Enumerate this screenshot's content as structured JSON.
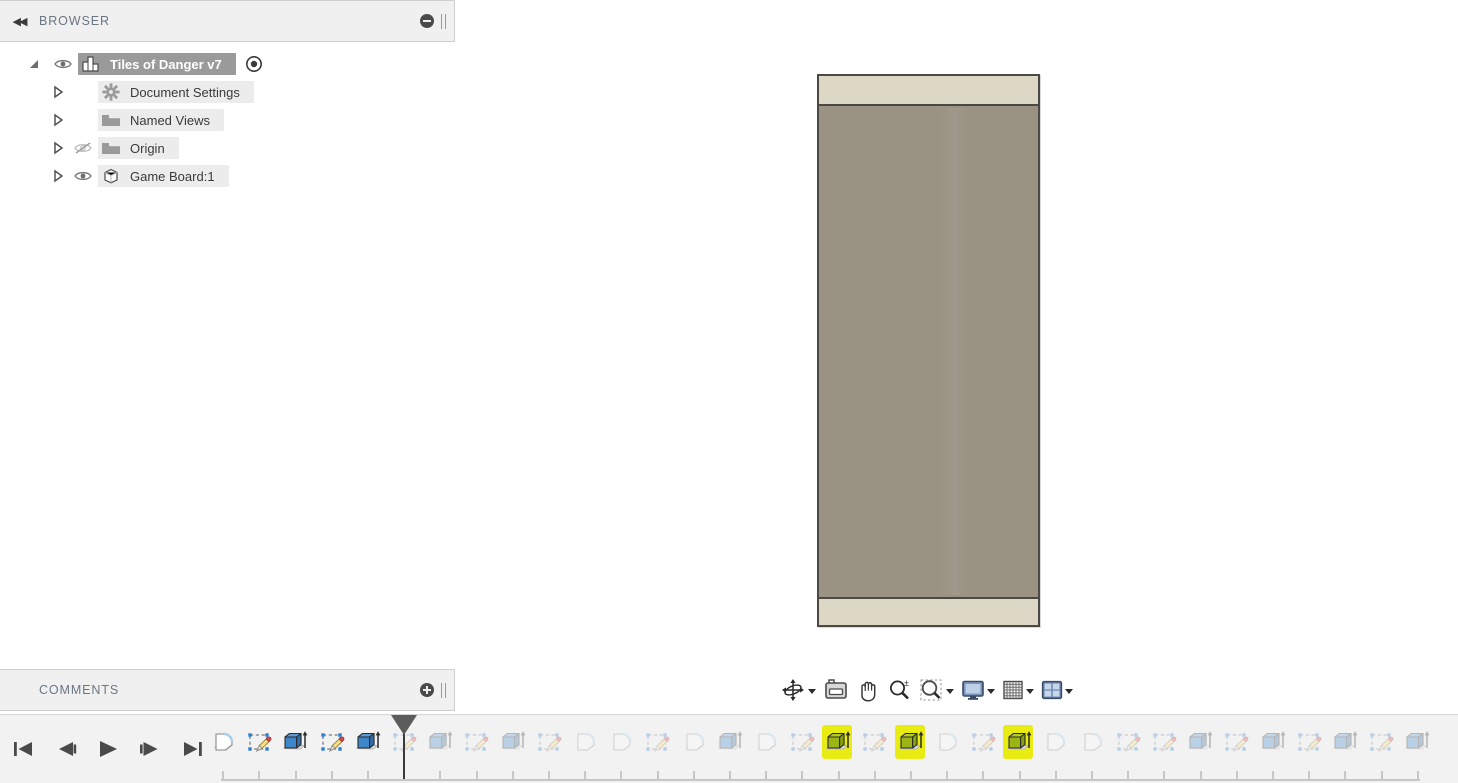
{
  "app": {
    "background": "#ffffff"
  },
  "browser": {
    "title": "BROWSER",
    "collapse_icon": "double-left-arrow-icon",
    "minimize_icon": "minus-circle-icon",
    "grip_icon": "drag-grip-icon",
    "tree": [
      {
        "label": "Tiles of Danger v7",
        "icon": "component-icon",
        "expander": "expanded-triangle-icon",
        "eye": "eye-visible-icon",
        "selected": true,
        "indent": 0,
        "has_target": true,
        "target_icon": "activate-component-icon"
      },
      {
        "label": "Document Settings",
        "icon": "gear-icon",
        "expander": "collapsed-triangle-icon",
        "eye": null,
        "selected": false,
        "indent": 1,
        "has_target": false
      },
      {
        "label": "Named Views",
        "icon": "folder-icon",
        "expander": "collapsed-triangle-icon",
        "eye": null,
        "selected": false,
        "indent": 1,
        "has_target": false
      },
      {
        "label": "Origin",
        "icon": "folder-icon",
        "expander": "collapsed-triangle-icon",
        "eye": "eye-hidden-icon",
        "selected": false,
        "indent": 1,
        "has_target": false
      },
      {
        "label": "Game Board:1",
        "icon": "body-cube-icon",
        "expander": "collapsed-triangle-icon",
        "eye": "eye-visible-icon",
        "selected": false,
        "indent": 1,
        "has_target": false
      }
    ]
  },
  "comments": {
    "title": "COMMENTS",
    "add_icon": "plus-circle-icon",
    "grip_icon": "drag-grip-icon"
  },
  "viewport": {
    "model": {
      "name": "game-board-model",
      "body_color": "#9a9384",
      "band_color": "#ddd8c6",
      "edge_color": "#4a4944"
    }
  },
  "navbar": {
    "buttons": [
      {
        "name": "orbit-icon",
        "label": "Orbit",
        "has_caret": true
      },
      {
        "name": "look-at-icon",
        "label": "Look At",
        "has_caret": false
      },
      {
        "name": "pan-hand-icon",
        "label": "Pan",
        "has_caret": false
      },
      {
        "name": "zoom-icon",
        "label": "Zoom",
        "has_caret": false
      },
      {
        "name": "zoom-window-icon",
        "label": "Zoom Window",
        "has_caret": true
      },
      {
        "name": "display-settings-icon",
        "label": "Display Settings",
        "has_caret": true
      },
      {
        "name": "grid-snap-icon",
        "label": "Grid and Snaps",
        "has_caret": true
      },
      {
        "name": "viewports-icon",
        "label": "Viewports",
        "has_caret": true
      }
    ]
  },
  "timeline": {
    "playback": [
      {
        "name": "skip-to-start-button",
        "icon": "skip-start-icon"
      },
      {
        "name": "step-back-button",
        "icon": "step-back-icon"
      },
      {
        "name": "play-button",
        "icon": "play-icon"
      },
      {
        "name": "step-forward-button",
        "icon": "step-forward-icon"
      },
      {
        "name": "skip-to-end-button",
        "icon": "skip-end-icon"
      }
    ],
    "playhead_index": 5,
    "highlight_color": "#e8ec12",
    "features": [
      {
        "type": "component",
        "state": "active"
      },
      {
        "type": "sketch",
        "state": "active"
      },
      {
        "type": "extrude",
        "state": "active"
      },
      {
        "type": "sketch",
        "state": "active"
      },
      {
        "type": "extrude",
        "state": "active"
      },
      {
        "type": "sketch",
        "state": "rolled-back"
      },
      {
        "type": "extrude",
        "state": "rolled-back"
      },
      {
        "type": "sketch",
        "state": "rolled-back"
      },
      {
        "type": "extrude",
        "state": "rolled-back"
      },
      {
        "type": "sketch",
        "state": "rolled-back"
      },
      {
        "type": "fillet",
        "state": "rolled-back"
      },
      {
        "type": "fillet",
        "state": "rolled-back"
      },
      {
        "type": "sketch",
        "state": "rolled-back"
      },
      {
        "type": "fillet",
        "state": "rolled-back"
      },
      {
        "type": "extrude",
        "state": "rolled-back"
      },
      {
        "type": "fillet",
        "state": "rolled-back"
      },
      {
        "type": "sketch",
        "state": "rolled-back"
      },
      {
        "type": "extrude",
        "state": "highlighted"
      },
      {
        "type": "sketch",
        "state": "rolled-back"
      },
      {
        "type": "extrude",
        "state": "highlighted"
      },
      {
        "type": "fillet",
        "state": "rolled-back"
      },
      {
        "type": "sketch",
        "state": "rolled-back"
      },
      {
        "type": "extrude",
        "state": "highlighted"
      },
      {
        "type": "fillet",
        "state": "rolled-back"
      },
      {
        "type": "fillet",
        "state": "rolled-back"
      },
      {
        "type": "sketch",
        "state": "rolled-back"
      },
      {
        "type": "sketch",
        "state": "rolled-back"
      },
      {
        "type": "extrude",
        "state": "rolled-back"
      },
      {
        "type": "sketch",
        "state": "rolled-back"
      },
      {
        "type": "extrude",
        "state": "rolled-back"
      },
      {
        "type": "sketch",
        "state": "rolled-back"
      },
      {
        "type": "extrude",
        "state": "rolled-back"
      },
      {
        "type": "sketch",
        "state": "rolled-back"
      },
      {
        "type": "extrude",
        "state": "rolled-back"
      }
    ]
  }
}
